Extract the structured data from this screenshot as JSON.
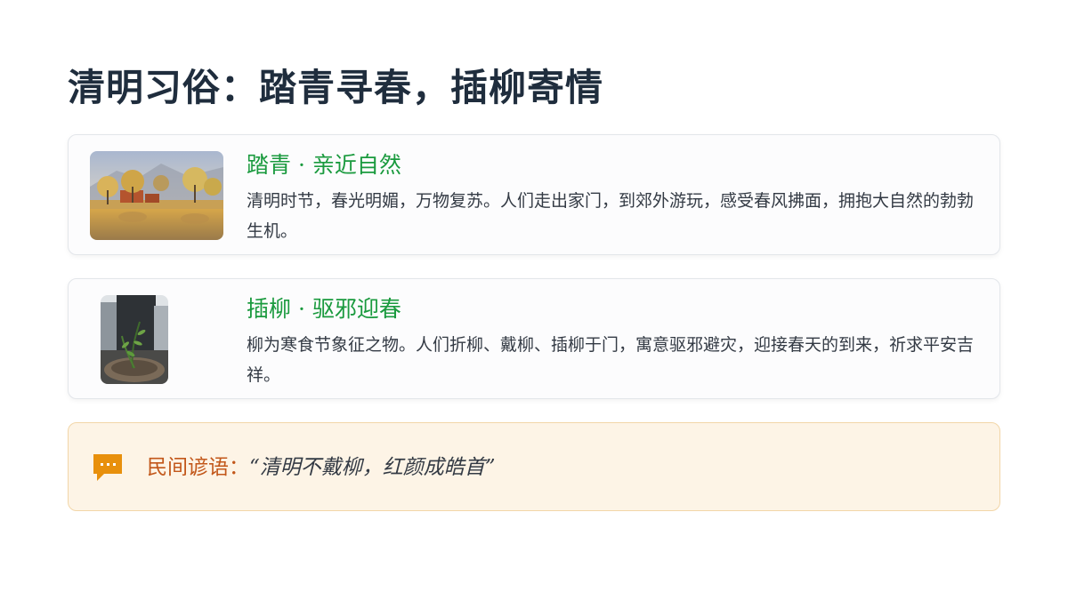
{
  "page": {
    "title": "清明习俗：踏青寻春，插柳寄情"
  },
  "cards": [
    {
      "title": "踏青 · 亲近自然",
      "text": "清明时节，春光明媚，万物复苏。人们走出家门，到郊外游玩，感受春风拂面，拥抱大自然的勃勃生机。",
      "image": "lake-trees-photo"
    },
    {
      "title": "插柳 · 驱邪迎春",
      "text": "柳为寒食节象征之物。人们折柳、戴柳、插柳于门，寓意驱邪避灾，迎接春天的到来，祈求平安吉祥。",
      "image": "willow-bowl-photo"
    }
  ],
  "proverb": {
    "label": "民间谚语：",
    "quote": "“清明不戴柳，红颜成皓首”",
    "icon": "chat-bubble-icon"
  },
  "colors": {
    "title": "#1f2d3d",
    "card_heading": "#1a9a3e",
    "body_text": "#333a44",
    "proverb_label": "#c2571a",
    "proverb_bg": "#fdf4e6",
    "proverb_icon": "#e8900c"
  }
}
